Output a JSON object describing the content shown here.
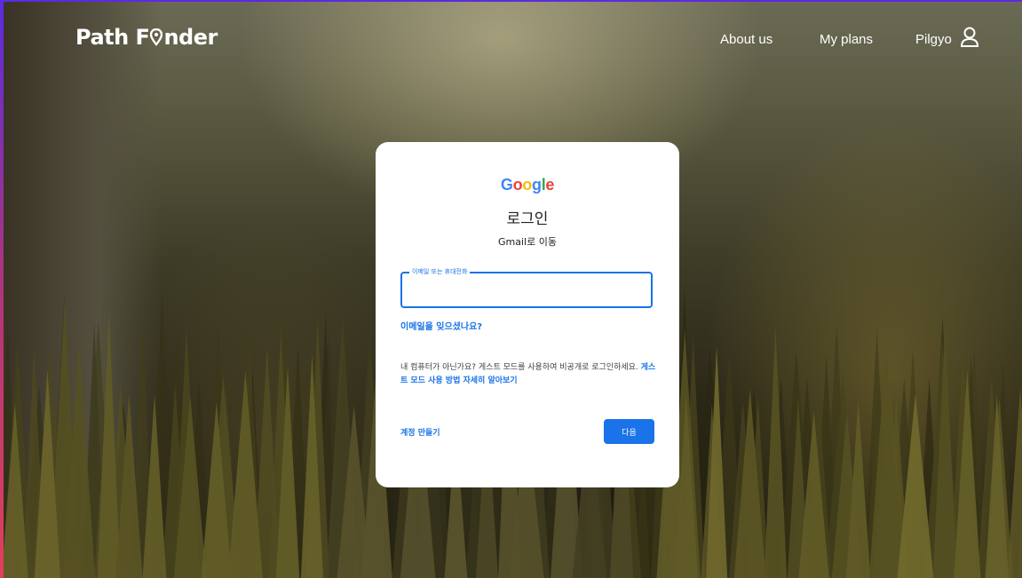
{
  "brand": {
    "logo_text": "Path F",
    "logo_text2": "nder"
  },
  "nav": {
    "about": "About us",
    "plans": "My plans",
    "user": "Pilgyo",
    "user_icon": "user-icon"
  },
  "login": {
    "google": [
      "G",
      "o",
      "o",
      "g",
      "l",
      "e"
    ],
    "google_colors": [
      "#4285f4",
      "#ea4335",
      "#fbbc05",
      "#4285f4",
      "#34a853",
      "#ea4335"
    ],
    "title": "로그인",
    "subtitle": "Gmail로 이동",
    "email_label": "이메일 또는 휴대전화",
    "email_value": "",
    "forgot": "이메일을 잊으셨나요?",
    "guest_text": "내 컴퓨터가 아닌가요? 게스트 모드를 사용하여 비공개로 로그인하세요. ",
    "guest_link": "게스트 모드 사용 방법 자세히 알아보기",
    "create_account": "계정 만들기",
    "next": "다음"
  },
  "colors": {
    "accent": "#1a73e8"
  }
}
